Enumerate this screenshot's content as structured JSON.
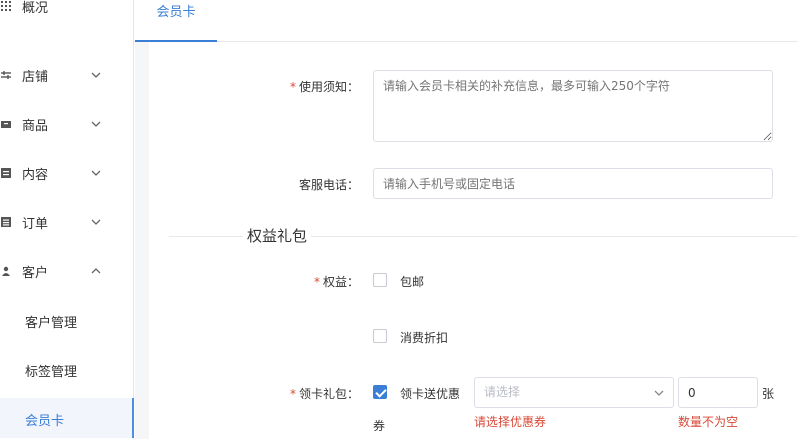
{
  "sidebar": {
    "items": [
      {
        "label": "概况",
        "icon": "grid-icon"
      },
      {
        "label": "店铺",
        "icon": "store-icon"
      },
      {
        "label": "商品",
        "icon": "box-icon"
      },
      {
        "label": "内容",
        "icon": "document-icon"
      },
      {
        "label": "订单",
        "icon": "list-icon"
      },
      {
        "label": "客户",
        "icon": "user-icon"
      }
    ],
    "sub_items": [
      {
        "label": "客户管理"
      },
      {
        "label": "标签管理"
      },
      {
        "label": "会员卡",
        "active": true
      }
    ]
  },
  "tabs": [
    {
      "label": "会员卡"
    }
  ],
  "form": {
    "notice": {
      "label": "使用须知：",
      "placeholder": "请输入会员卡相关的补充信息，最多可输入250个字符"
    },
    "phone": {
      "label": "客服电话：",
      "placeholder": "请输入手机号或固定电话"
    },
    "section_title": "权益礼包",
    "benefits": {
      "label": "权益：",
      "options": [
        {
          "label": "包邮",
          "checked": false
        },
        {
          "label": "消费折扣",
          "checked": false
        }
      ]
    },
    "gift": {
      "label": "领卡礼包：",
      "option_label_line1": "领卡送优惠",
      "option_label_line2": "券",
      "checked": true,
      "coupon_placeholder": "请选择",
      "quantity_value": "0",
      "unit": "张",
      "coupon_error": "请选择优惠券",
      "quantity_error": "数量不为空"
    }
  },
  "colors": {
    "accent": "#3a7ed6",
    "error": "#d94a38",
    "required": "#d94a38"
  }
}
